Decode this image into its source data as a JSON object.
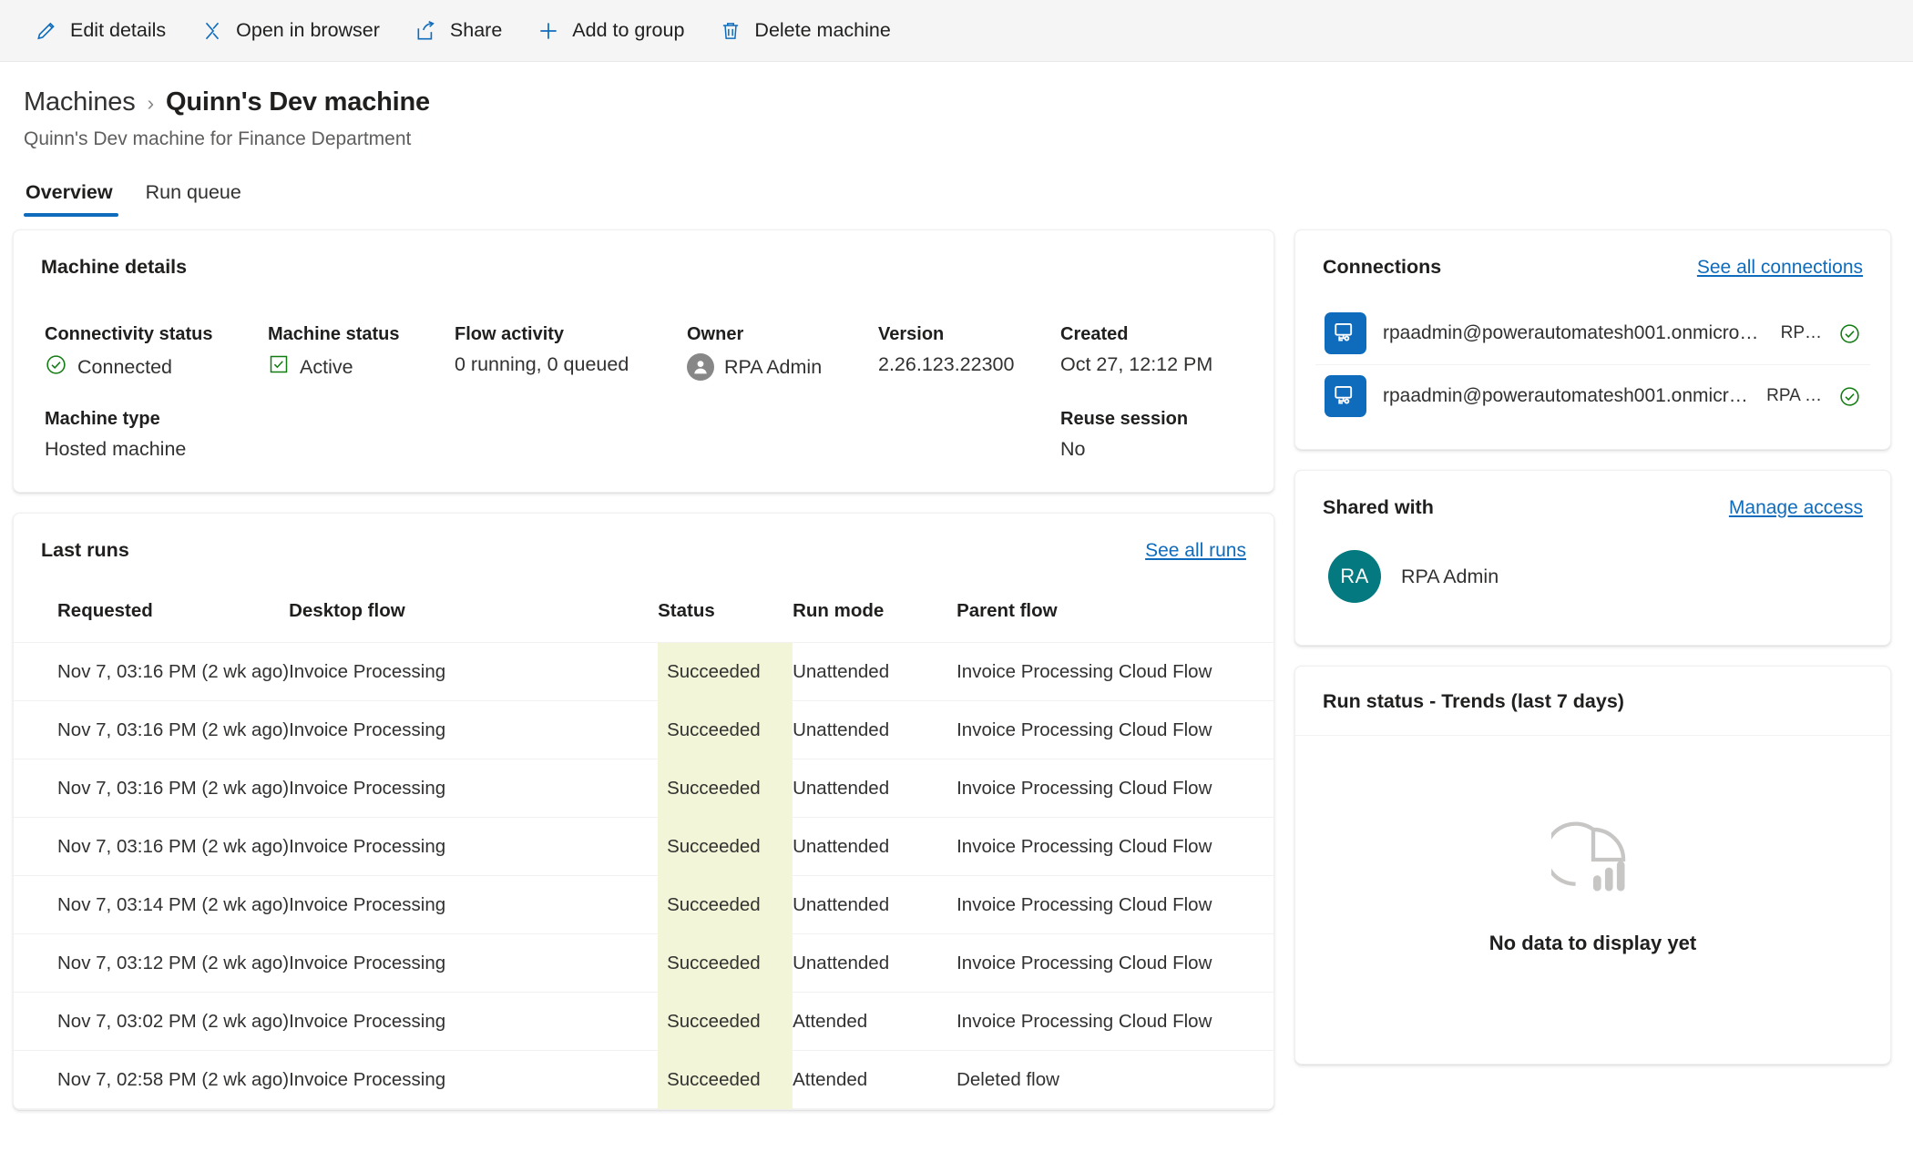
{
  "commandbar": {
    "items": [
      {
        "label": "Edit details",
        "icon": "pencil-icon"
      },
      {
        "label": "Open in browser",
        "icon": "open-in-browser-icon"
      },
      {
        "label": "Share",
        "icon": "share-icon"
      },
      {
        "label": "Add to group",
        "icon": "plus-icon"
      },
      {
        "label": "Delete machine",
        "icon": "trash-icon"
      }
    ]
  },
  "header": {
    "breadcrumb_parent": "Machines",
    "breadcrumb_separator": "›",
    "breadcrumb_current": "Quinn's Dev machine",
    "subtitle": "Quinn's Dev machine for Finance Department"
  },
  "tabs": [
    {
      "label": "Overview",
      "active": true
    },
    {
      "label": "Run queue",
      "active": false
    }
  ],
  "machine_details": {
    "title": "Machine details",
    "connectivity_status": {
      "label": "Connectivity status",
      "value": "Connected",
      "icon": "circle-check-icon",
      "color": "#107c10"
    },
    "machine_status": {
      "label": "Machine status",
      "value": "Active",
      "icon": "checkbox-checked-icon",
      "color": "#107c10"
    },
    "flow_activity": {
      "label": "Flow activity",
      "value": "0 running, 0 queued"
    },
    "owner": {
      "label": "Owner",
      "value": "RPA Admin",
      "icon": "person-avatar-icon"
    },
    "version": {
      "label": "Version",
      "value": "2.26.123.22300"
    },
    "created": {
      "label": "Created",
      "value": "Oct 27, 12:12 PM"
    },
    "machine_type": {
      "label": "Machine type",
      "value": "Hosted machine"
    },
    "reuse_session": {
      "label": "Reuse session",
      "value": "No"
    }
  },
  "last_runs": {
    "title": "Last runs",
    "see_all_label": "See all runs",
    "columns": [
      "Requested",
      "Desktop flow",
      "Status",
      "Run mode",
      "Parent flow"
    ],
    "rows": [
      {
        "requested": "Nov 7, 03:16 PM (2 wk ago)",
        "flow": "Invoice Processing",
        "status": "Succeeded",
        "mode": "Unattended",
        "parent": "Invoice Processing Cloud Flow",
        "parent_deleted": false
      },
      {
        "requested": "Nov 7, 03:16 PM (2 wk ago)",
        "flow": "Invoice Processing",
        "status": "Succeeded",
        "mode": "Unattended",
        "parent": "Invoice Processing Cloud Flow",
        "parent_deleted": false
      },
      {
        "requested": "Nov 7, 03:16 PM (2 wk ago)",
        "flow": "Invoice Processing",
        "status": "Succeeded",
        "mode": "Unattended",
        "parent": "Invoice Processing Cloud Flow",
        "parent_deleted": false
      },
      {
        "requested": "Nov 7, 03:16 PM (2 wk ago)",
        "flow": "Invoice Processing",
        "status": "Succeeded",
        "mode": "Unattended",
        "parent": "Invoice Processing Cloud Flow",
        "parent_deleted": false
      },
      {
        "requested": "Nov 7, 03:14 PM (2 wk ago)",
        "flow": "Invoice Processing",
        "status": "Succeeded",
        "mode": "Unattended",
        "parent": "Invoice Processing Cloud Flow",
        "parent_deleted": false
      },
      {
        "requested": "Nov 7, 03:12 PM (2 wk ago)",
        "flow": "Invoice Processing",
        "status": "Succeeded",
        "mode": "Unattended",
        "parent": "Invoice Processing Cloud Flow",
        "parent_deleted": false
      },
      {
        "requested": "Nov 7, 03:02 PM (2 wk ago)",
        "flow": "Invoice Processing",
        "status": "Succeeded",
        "mode": "Attended",
        "parent": "Invoice Processing Cloud Flow",
        "parent_deleted": false
      },
      {
        "requested": "Nov 7, 02:58 PM (2 wk ago)",
        "flow": "Invoice Processing",
        "status": "Succeeded",
        "mode": "Attended",
        "parent": "Deleted flow",
        "parent_deleted": true
      }
    ]
  },
  "connections": {
    "title": "Connections",
    "see_all_label": "See all connections",
    "items": [
      {
        "name": "rpaadmin@powerautomatesh001.onmicros…",
        "owner": "RP…",
        "status_icon": "circle-check-icon",
        "icon": "desktop-flow-icon"
      },
      {
        "name": "rpaadmin@powerautomatesh001.onmicro…",
        "owner": "RPA …",
        "status_icon": "circle-check-icon",
        "icon": "desktop-flow-icon"
      }
    ]
  },
  "shared_with": {
    "title": "Shared with",
    "manage_label": "Manage access",
    "people": [
      {
        "initials": "RA",
        "name": "RPA Admin",
        "color": "#04797f"
      }
    ]
  },
  "trends": {
    "title": "Run status - Trends (last 7 days)",
    "empty_text": "No data to display yet",
    "empty_icon": "pie-chart-bars-icon"
  },
  "theme": {
    "accent": "#0f6cbd",
    "success": "#107c10",
    "status_cell_bg": "#f2f5d8",
    "avatar_teal": "#04797f"
  }
}
